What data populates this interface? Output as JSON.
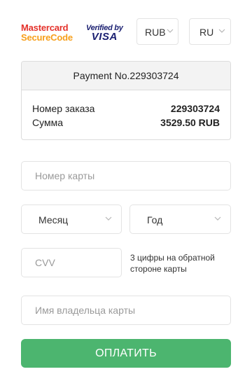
{
  "header": {
    "mastercard_line1": "Mastercard",
    "mastercard_line2": "SecureCode",
    "visa_line1": "Verified by",
    "visa_line2": "VISA",
    "currency_selected": "RUB",
    "language_selected": "RU"
  },
  "payment": {
    "title": "Payment No.229303724",
    "order_label": "Номер заказа",
    "order_value": "229303724",
    "sum_label": "Сумма",
    "sum_value": "3529.50 RUB"
  },
  "form": {
    "card_placeholder": "Номер карты",
    "month_selected": "Месяц",
    "year_selected": "Год",
    "cvv_placeholder": "CVV",
    "cvv_hint": "3 цифры на обратной стороне карты",
    "holder_placeholder": "Имя владельца карты",
    "submit_label": "ОПЛАТИТЬ"
  },
  "colors": {
    "mastercard_red": "#e4322b",
    "mastercard_orange": "#f79f1a",
    "visa_blue": "#1a1f71",
    "submit_green": "#4cb56f"
  },
  "icons": {
    "currency_select": "chevron-down-icon",
    "language_select": "chevron-down-icon",
    "month_select": "chevron-down-icon",
    "year_select": "chevron-down-icon"
  }
}
